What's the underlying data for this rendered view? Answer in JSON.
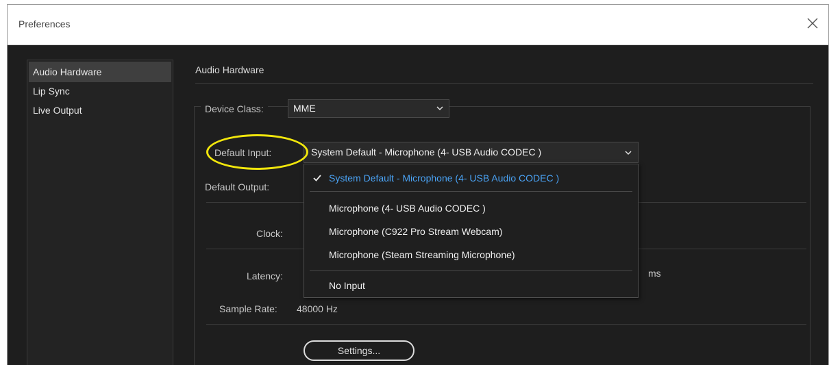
{
  "window": {
    "title": "Preferences"
  },
  "sidebar": {
    "items": [
      {
        "label": "Audio Hardware",
        "active": true
      },
      {
        "label": "Lip Sync",
        "active": false
      },
      {
        "label": "Live Output",
        "active": false
      }
    ]
  },
  "panel": {
    "title": "Audio Hardware",
    "device_class": {
      "label": "Device Class:",
      "value": "MME"
    },
    "default_input": {
      "label": "Default Input:",
      "value": "System Default - Microphone (4- USB Audio CODEC )"
    },
    "default_output": {
      "label": "Default Output:"
    },
    "clock": {
      "label": "Clock:"
    },
    "latency": {
      "label": "Latency:",
      "unit": "ms"
    },
    "sample_rate": {
      "label": "Sample Rate:",
      "value": "48000 Hz"
    },
    "settings_button": "Settings..."
  },
  "dropdown": {
    "options": [
      {
        "label": "System Default - Microphone (4- USB Audio CODEC )",
        "selected": true
      },
      {
        "label": "Microphone (4- USB Audio CODEC )",
        "selected": false
      },
      {
        "label": "Microphone (C922 Pro Stream Webcam)",
        "selected": false
      },
      {
        "label": "Microphone (Steam Streaming Microphone)",
        "selected": false
      },
      {
        "label": "No Input",
        "selected": false
      }
    ]
  },
  "colors": {
    "background": "#1e1e1e",
    "accent_selected": "#4aa3f5",
    "highlight_ellipse": "#f1e60c"
  },
  "icons": [
    "close-icon",
    "chevron-down-icon",
    "checkmark-icon"
  ]
}
